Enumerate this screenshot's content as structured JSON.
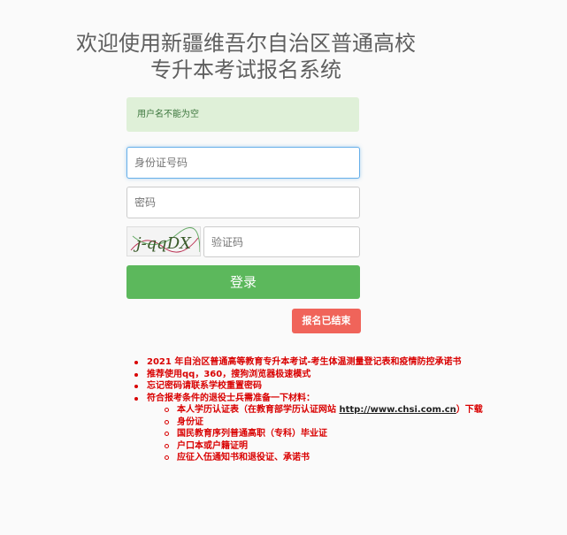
{
  "header": {
    "title_line1": "欢迎使用新疆维吾尔自治区普通高校",
    "title_line2": "专升本考试报名系统"
  },
  "alert": {
    "message": "用户名不能为空"
  },
  "form": {
    "id_placeholder": "身份证号码",
    "password_placeholder": "密码",
    "captcha_text": "j-qqDX",
    "captcha_placeholder": "验证码",
    "login_label": "登录",
    "closed_label": "报名已结束"
  },
  "notes": {
    "items": [
      "2021 年自治区普通高等教育专升本考试-考生体温测量登记表和疫情防控承诺书",
      "推荐使用qq，360，搜狗浏览器极速模式",
      "忘记密码请联系学校重置密码",
      "符合报考条件的退役士兵需准备一下材料："
    ],
    "subitems": {
      "first_prefix": "本人学历认证表（在教育部学历认证网站 ",
      "first_link": "http://www.chsi.com.cn",
      "first_suffix": "）下载",
      "rest": [
        "身份证",
        "国民教育序列普通高职（专科）毕业证",
        "户口本或户籍证明",
        "应征入伍通知书和退役证、承诺书"
      ]
    }
  }
}
